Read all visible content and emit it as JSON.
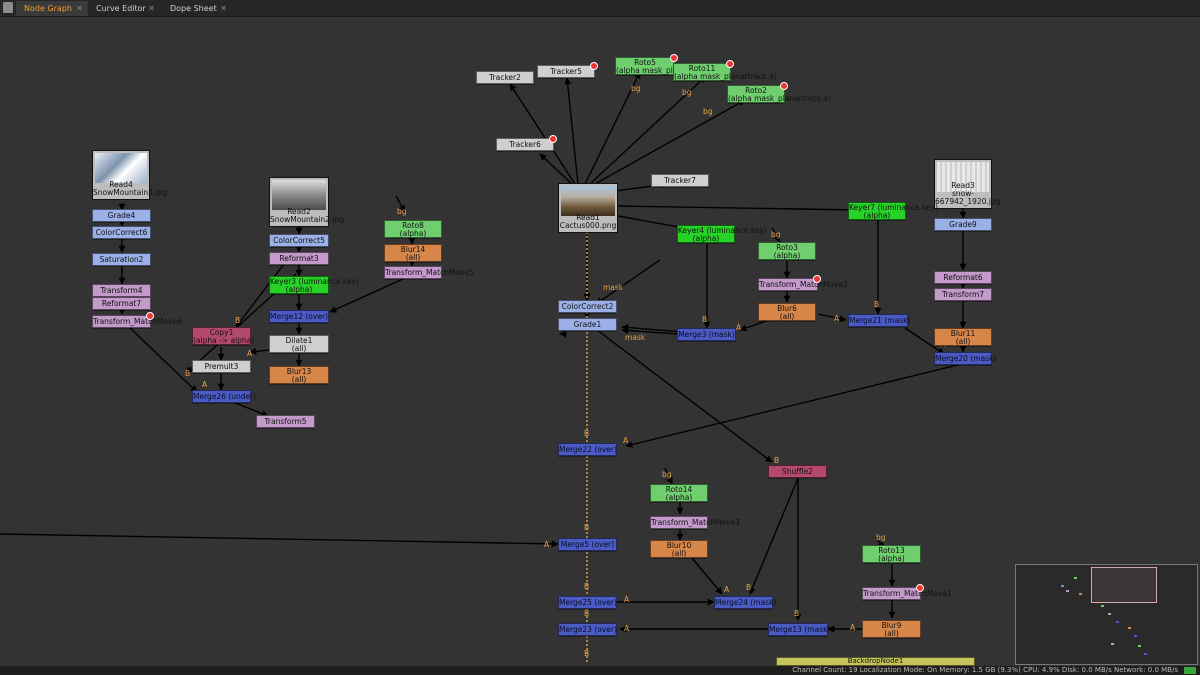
{
  "tabs": [
    {
      "label": "Node Graph",
      "active": true
    },
    {
      "label": "Curve Editor",
      "active": false
    },
    {
      "label": "Dope Sheet",
      "active": false
    }
  ],
  "colors": {
    "merge": "#4a5cc4",
    "color_op": "#9ab0e6",
    "roto": "#6fcf6f",
    "keyer": "#27d327",
    "blur": "#d7864a",
    "transform": "#c49acb",
    "copy_shuffle": "#b34a6e",
    "tracker": "#cfcfcf",
    "wire_label": "#e6a24a",
    "background": "#333333"
  },
  "reads": [
    {
      "id": "read4",
      "name": "Read4",
      "file": "SnowMountain3.jpg"
    },
    {
      "id": "read2",
      "name": "Read2",
      "file": "SnowMountain2.jpg"
    },
    {
      "id": "read1",
      "name": "Read1",
      "file": "Cactus000.png"
    },
    {
      "id": "read3",
      "name": "Read3",
      "file": "snow-667942_1920.jpg"
    }
  ],
  "nodes": {
    "grade4": {
      "name": "Grade4"
    },
    "colorcorrect6": {
      "name": "ColorCorrect6"
    },
    "saturation2": {
      "name": "Saturation2"
    },
    "transform4": {
      "name": "Transform4"
    },
    "reformat7": {
      "name": "Reformat7"
    },
    "tmm6": {
      "name": "Transform_MatchMove6"
    },
    "colorcorrect5": {
      "name": "ColorCorrect5"
    },
    "reformat3": {
      "name": "Reformat3"
    },
    "keyer3": {
      "name": "Keyer3 (luminance key)",
      "sub": "(alpha)"
    },
    "merge12": {
      "name": "Merge12 (over)"
    },
    "dilate1": {
      "name": "Dilate1",
      "sub": "(all)"
    },
    "blur13": {
      "name": "Blur13",
      "sub": "(all)"
    },
    "copy1": {
      "name": "Copy1",
      "sub": "(alpha -> alpha)"
    },
    "premult3": {
      "name": "Premult3"
    },
    "merge26": {
      "name": "Merge26 (under)"
    },
    "transform5": {
      "name": "Transform5"
    },
    "roto8": {
      "name": "Roto8",
      "sub": "(alpha)"
    },
    "blur14": {
      "name": "Blur14",
      "sub": "(all)"
    },
    "tmm5": {
      "name": "Transform_MatchMove5"
    },
    "tracker2": {
      "name": "Tracker2"
    },
    "tracker5": {
      "name": "Tracker5"
    },
    "roto5": {
      "name": "Roto5",
      "sub": "(alpha mask_planartrack.a)"
    },
    "roto11": {
      "name": "Roto11",
      "sub": "(alpha mask_planartrack.a)"
    },
    "roto2": {
      "name": "Roto2",
      "sub": "(alpha mask_planartrack.a)"
    },
    "tracker6": {
      "name": "Tracker6"
    },
    "tracker7": {
      "name": "Tracker7"
    },
    "keyer4": {
      "name": "Keyer4 (luminance key)",
      "sub": "(alpha)"
    },
    "keyer7": {
      "name": "Keyer7 (luminance key)",
      "sub": "(alpha)"
    },
    "colorcorrect2": {
      "name": "ColorCorrect2"
    },
    "grade1": {
      "name": "Grade1"
    },
    "merge3": {
      "name": "Merge3 (mask)"
    },
    "roto3": {
      "name": "Roto3",
      "sub": "(alpha)"
    },
    "tmm2": {
      "name": "Transform_MatchMove2"
    },
    "blur6": {
      "name": "Blur6",
      "sub": "(all)"
    },
    "merge21": {
      "name": "Merge21 (mask)"
    },
    "grade9": {
      "name": "Grade9"
    },
    "reformat6": {
      "name": "Reformat6"
    },
    "transform7": {
      "name": "Transform7"
    },
    "blur11": {
      "name": "Blur11",
      "sub": "(all)"
    },
    "merge20": {
      "name": "Merge20 (mask)"
    },
    "merge22": {
      "name": "Merge22 (over)"
    },
    "shuffle2": {
      "name": "Shuffle2"
    },
    "roto14": {
      "name": "Roto14",
      "sub": "(alpha)"
    },
    "tmm3": {
      "name": "Transform_MatchMove3"
    },
    "blur10": {
      "name": "Blur10",
      "sub": "(all)"
    },
    "merge5": {
      "name": "Merge5 (over)"
    },
    "merge25": {
      "name": "Merge25 (over)"
    },
    "merge24": {
      "name": "Merge24 (mask)"
    },
    "merge23": {
      "name": "Merge23 (over)"
    },
    "merge13": {
      "name": "Merge13 (mask)"
    },
    "roto13": {
      "name": "Roto13",
      "sub": "(alpha)"
    },
    "tmm1": {
      "name": "Transform_MatchMove1"
    },
    "blur9": {
      "name": "Blur9",
      "sub": "(all)"
    },
    "backdrop": {
      "name": "BackdropNode1"
    }
  },
  "wire_labels": {
    "bg": "bg",
    "mask": "mask",
    "A": "A",
    "B": "B"
  },
  "status": "Channel Count: 19  Localization Mode: On  Memory: 1.5 GB (9.3%)  CPU: 4.9%  Disk: 0.0 MB/s  Network: 0.0 MB/s"
}
